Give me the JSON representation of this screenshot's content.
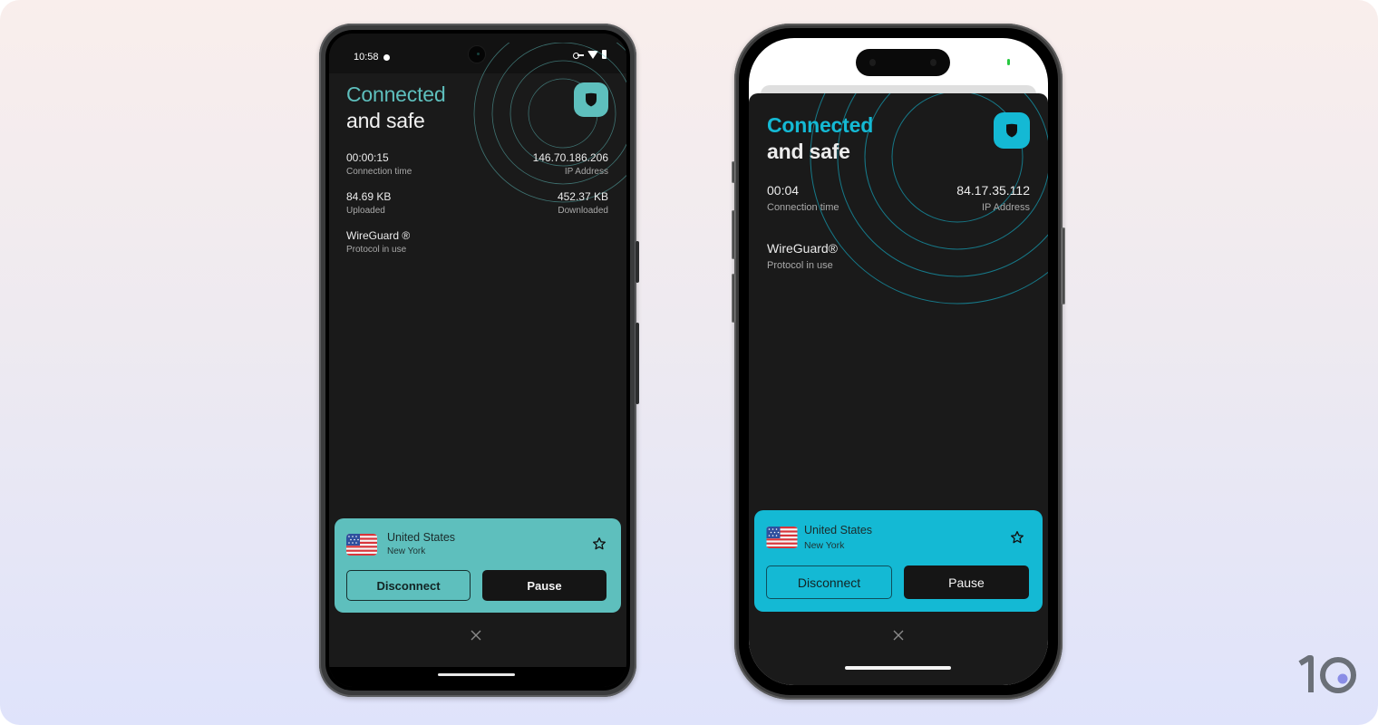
{
  "page": {
    "brand_logo_text": "10",
    "colors": {
      "android_accent": "#5ebfbd",
      "ios_accent": "#14b9d4",
      "screen_bg": "#1a1a1a",
      "button_dark": "#151515"
    }
  },
  "android": {
    "status_bar": {
      "time": "10:58",
      "icons": [
        "notification-dot-icon",
        "vpn-key-icon",
        "wifi-icon",
        "battery-icon"
      ]
    },
    "status": {
      "line1": "Connected",
      "line2": "and safe",
      "shield_icon": "shield-icon"
    },
    "stats": {
      "connection_time": {
        "value": "00:00:15",
        "label": "Connection time"
      },
      "ip_address": {
        "value": "146.70.186.206",
        "label": "IP Address"
      },
      "uploaded": {
        "value": "84.69 KB",
        "label": "Uploaded"
      },
      "downloaded": {
        "value": "452.37 KB",
        "label": "Downloaded"
      },
      "protocol": {
        "value": "WireGuard ®",
        "label": "Protocol in use"
      }
    },
    "location_card": {
      "flag_icon": "us-flag-icon",
      "country": "United States",
      "city": "New York",
      "favorite_icon": "star-icon",
      "disconnect_label": "Disconnect",
      "pause_label": "Pause"
    },
    "close_icon": "close-icon"
  },
  "ios": {
    "status": {
      "line1": "Connected",
      "line2": "and safe",
      "shield_icon": "shield-icon"
    },
    "stats": {
      "connection_time": {
        "value": "00:04",
        "label": "Connection time"
      },
      "ip_address": {
        "value": "84.17.35.112",
        "label": "IP Address"
      },
      "protocol": {
        "value": "WireGuard®",
        "label": "Protocol in use"
      }
    },
    "location_card": {
      "flag_icon": "us-flag-icon",
      "country": "United States",
      "city": "New York",
      "favorite_icon": "star-icon",
      "disconnect_label": "Disconnect",
      "pause_label": "Pause"
    },
    "close_icon": "close-icon"
  }
}
